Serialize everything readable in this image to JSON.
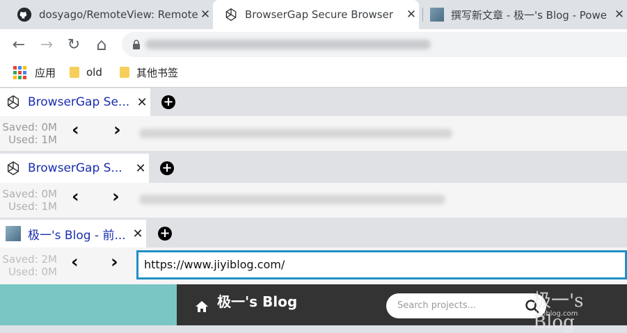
{
  "chrome": {
    "tabs": [
      {
        "title": "dosyago/RemoteView: Remote",
        "icon": "github-icon"
      },
      {
        "title": "BrowserGap Secure Browser",
        "icon": "browsergap-icon"
      },
      {
        "title": "撰写新文章 - 极一's Blog - Powe",
        "icon": "blog-favicon-icon"
      }
    ],
    "close_glyph": "✕"
  },
  "toolbar": {
    "back": "←",
    "forward": "→",
    "reload": "↻",
    "home": "⌂"
  },
  "bookmarks": [
    {
      "label": "应用",
      "icon": "apps-icon"
    },
    {
      "label": "old",
      "icon": "folder-icon"
    },
    {
      "label": "其他书签",
      "icon": "folder-icon"
    }
  ],
  "browsergap": [
    {
      "tab_title": "BrowserGap Se...",
      "saved": "Saved: 0M",
      "used": "Used: 1M",
      "url": ""
    },
    {
      "tab_title": "BrowserGap S...",
      "saved": "Saved: 0M",
      "used": "Used: 1M",
      "url": ""
    },
    {
      "tab_title": "极一's Blog - 前...",
      "saved": "Saved: 2M",
      "used": "Used: 0M",
      "url": "https://www.jiyiblog.com/"
    }
  ],
  "glyphs": {
    "close": "✕",
    "plus": "+",
    "prev": "‹",
    "next": "›"
  },
  "page": {
    "blog_title": "极一's Blog",
    "search_placeholder": "Search projects...",
    "watermark": "极一's Blog",
    "watermark_sub": "jiyiblog.com"
  },
  "colors": {
    "link_blue": "#1a2db0",
    "url_border": "#1f8fc7",
    "page_teal": "#79c6c4",
    "page_dark": "#333333"
  }
}
